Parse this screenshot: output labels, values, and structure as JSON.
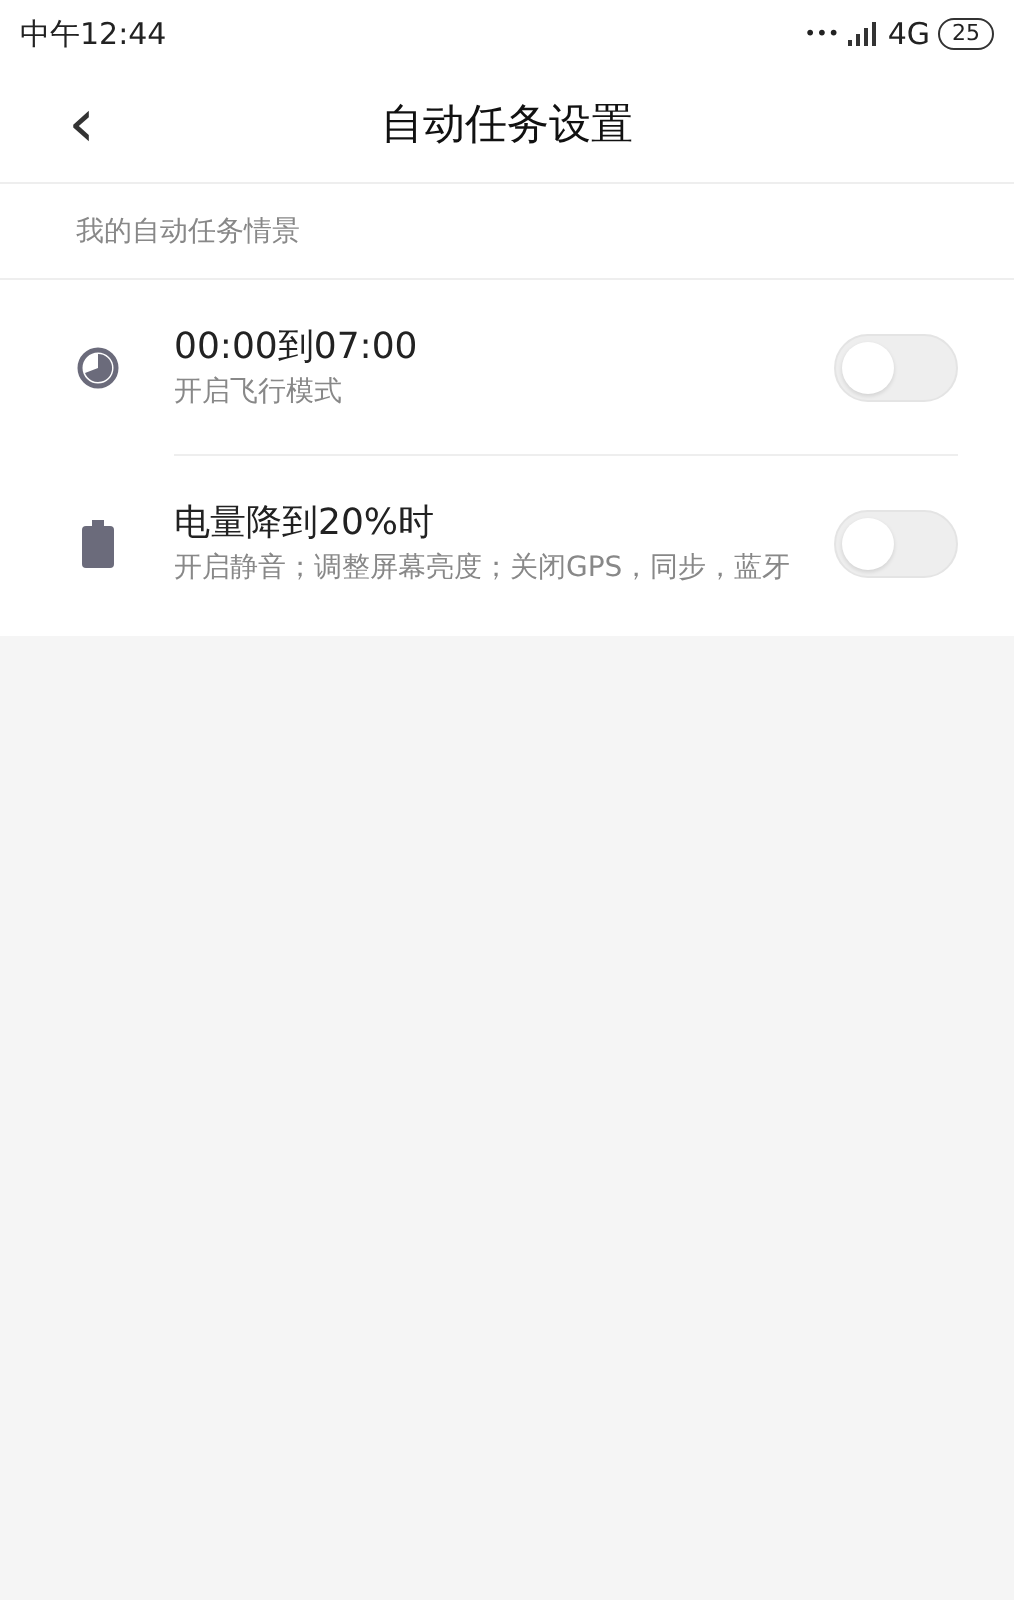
{
  "status_bar": {
    "time": "中午12:44",
    "dots": "•••",
    "network": "4G",
    "battery": "25"
  },
  "header": {
    "back": "‹",
    "title": "自动任务设置"
  },
  "section": {
    "title": "我的自动任务情景"
  },
  "tasks": [
    {
      "kind": "time",
      "title": "00:00到07:00",
      "description": "开启飞行模式",
      "on": false
    },
    {
      "kind": "battery",
      "title": "电量降到20%时",
      "description": "开启静音；调整屏幕亮度；关闭GPS，同步，蓝牙",
      "on": false
    }
  ]
}
